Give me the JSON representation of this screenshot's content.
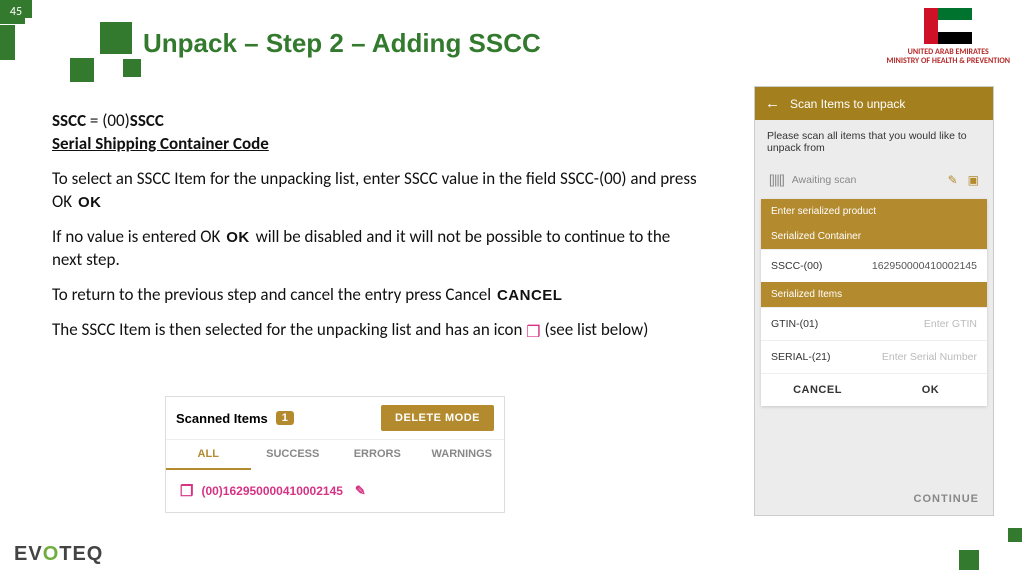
{
  "page": {
    "title": "Unpack – Step 2 – Adding SSCC",
    "number": "45"
  },
  "brand": {
    "line1": "UNITED ARAB EMIRATES",
    "line2": "MINISTRY OF HEALTH & PREVENTION",
    "footer_logo": "EVOTEQ"
  },
  "def": {
    "left": "SSCC",
    "mid": " = (00)",
    "right": "SSCC",
    "full": "Serial Shipping Container Code"
  },
  "body": {
    "p1": "To select an SSCC Item for the unpacking list, enter SSCC value in the field SSCC-(00) and press OK",
    "ok": "OK",
    "p2a": "If no value is entered OK",
    "p2b": " will be disabled and  it will not be possible to continue to the next step.",
    "p3": "To return to the previous step and cancel the entry press Cancel",
    "cancel": "CANCEL",
    "p4": "The SSCC Item is then selected for the unpacking list and has an icon",
    "p4b": "(see list below)"
  },
  "widget": {
    "title": "Scanned Items",
    "count": "1",
    "delete": "DELETE MODE",
    "tabs": [
      "ALL",
      "SUCCESS",
      "ERRORS",
      "WARNINGS"
    ],
    "row": "(00)162950000410002145"
  },
  "phone": {
    "title": "Scan Items to unpack",
    "instr": "Please scan all items that you would like to unpack from",
    "awaiting": "Awaiting scan",
    "hdr1": "Enter serialized product",
    "sub1": "Serialized Container",
    "f_sscc_k": "SSCC-(00)",
    "f_sscc_v": "162950000410002145",
    "sub2": "Serialized Items",
    "f_gtin_k": "GTIN-(01)",
    "f_gtin_v": "Enter GTIN",
    "f_ser_k": "SERIAL-(21)",
    "f_ser_v": "Enter Serial Number",
    "cancel": "CANCEL",
    "ok": "OK",
    "continue": "CONTINUE"
  }
}
